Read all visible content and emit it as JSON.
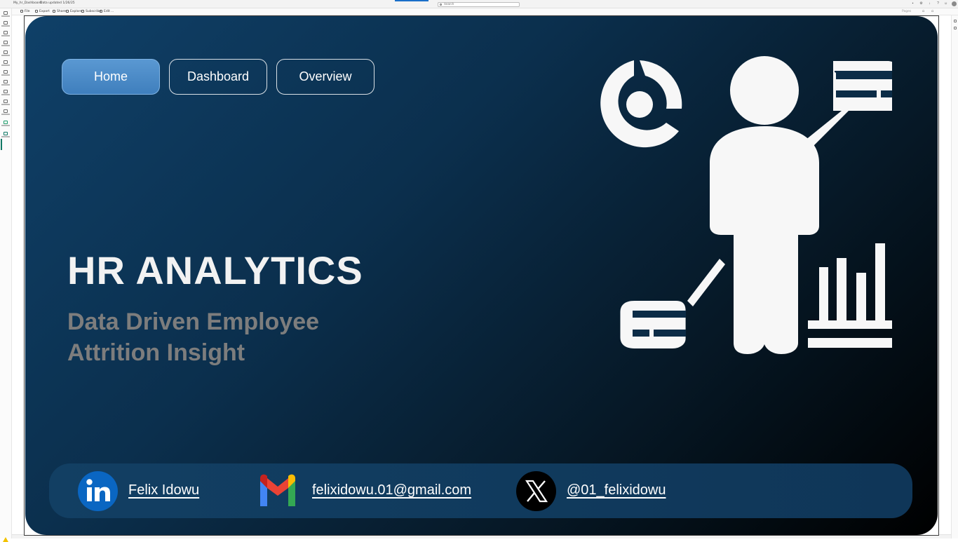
{
  "app": {
    "report_name": "My_hr_Dashboard",
    "data_updated": "Data updated 1/26/25",
    "search_placeholder": "Search"
  },
  "toolbar": {
    "file": "File",
    "export": "Export",
    "share": "Share",
    "explore": "Explore",
    "subscribe": "Subscribe",
    "edit": "Edit",
    "more": "...",
    "pages": "Pages"
  },
  "leftnav": {
    "items": [
      "Home",
      "Create",
      "Browse",
      "OneLake",
      "Apps",
      "Metrics",
      "Monitor",
      "Learn",
      "Real-Time",
      "Workloads",
      "Workspaces",
      "My workspace",
      "My_hr_Dashboard"
    ]
  },
  "report": {
    "nav": {
      "home": "Home",
      "dashboard": "Dashboard",
      "overview": "Overview"
    },
    "title": "HR ANALYTICS",
    "subtitle": "Data Driven Employee Attrition Insight",
    "contacts": {
      "name": "Felix Idowu",
      "email": "felixidowu.01@gmail.com",
      "handle": "@01_felixidowu"
    }
  },
  "colors": {
    "accent_button": "#4a8bc8",
    "linkedin": "#0a66c2",
    "gmail_red": "#ea4335",
    "gmail_blue": "#4285f4",
    "gmail_green": "#34a853",
    "gmail_yellow": "#fbbc04",
    "footer_bg": "#123f63"
  },
  "icons": [
    "linkedin-icon",
    "gmail-icon",
    "x-icon",
    "hr-analytics-illustration"
  ]
}
